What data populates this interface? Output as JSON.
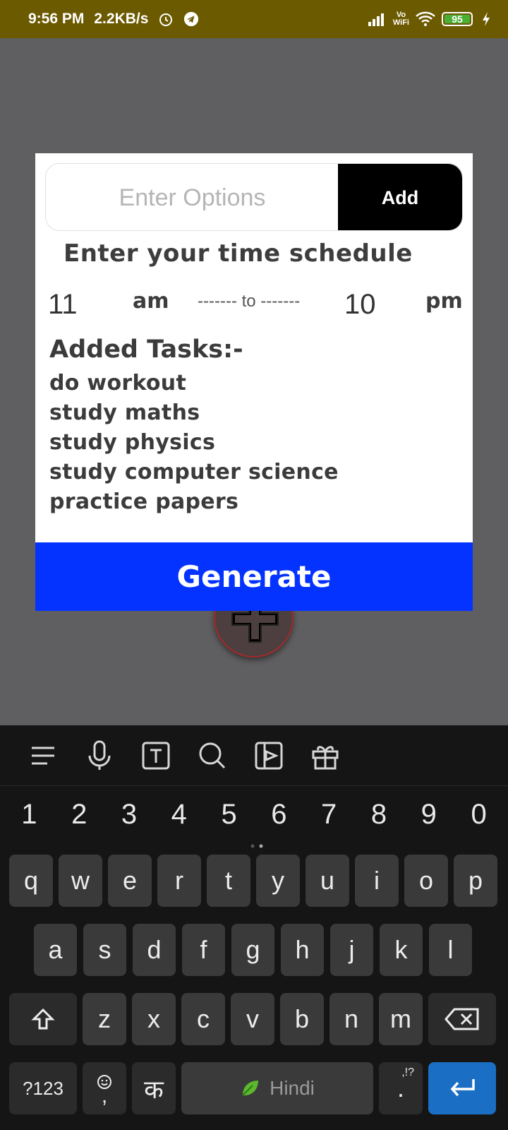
{
  "status_bar": {
    "time": "9:56 PM",
    "speed": "2.2KB/s",
    "volte_line1": "Vo",
    "volte_line2": "WiFi",
    "battery": "95"
  },
  "dialog": {
    "options_placeholder": "Enter Options",
    "add_label": "Add",
    "schedule_title": "Enter your time schedule",
    "start_time": "11",
    "start_period": "am",
    "separator": "------- to -------",
    "end_time": "10",
    "end_period": "pm",
    "tasks_title": "Added Tasks:-",
    "tasks": [
      "do workout",
      "study maths",
      "study physics",
      "study computer science",
      "practice papers"
    ],
    "generate_label": "Generate"
  },
  "keyboard": {
    "numbers": [
      "1",
      "2",
      "3",
      "4",
      "5",
      "6",
      "7",
      "8",
      "9",
      "0"
    ],
    "row1": [
      "q",
      "w",
      "e",
      "r",
      "t",
      "y",
      "u",
      "i",
      "o",
      "p"
    ],
    "row2": [
      "a",
      "s",
      "d",
      "f",
      "g",
      "h",
      "j",
      "k",
      "l"
    ],
    "row3": [
      "z",
      "x",
      "c",
      "v",
      "b",
      "n",
      "m"
    ],
    "symbols_key": "?123",
    "lang_key": "क",
    "space_label": "Hindi",
    "period_key": ".",
    "period_alt": ",!?",
    "emoji_sub": ","
  },
  "colors": {
    "status_bar": "#6c5a00",
    "generate_button": "#0433ff",
    "add_button": "#000000",
    "enter_key": "#1a6fc4"
  }
}
